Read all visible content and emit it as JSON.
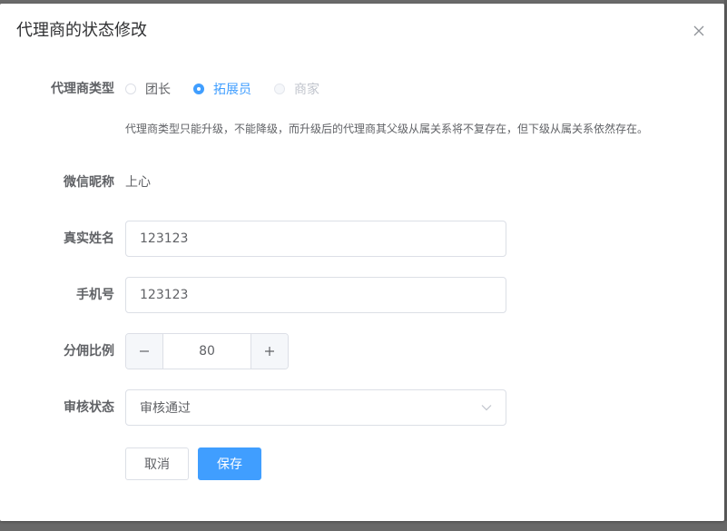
{
  "dialog": {
    "title": "代理商的状态修改",
    "close_icon": "close-icon"
  },
  "form": {
    "agent_type": {
      "label": "代理商类型",
      "options": [
        {
          "label": "团长",
          "state": "unchecked"
        },
        {
          "label": "拓展员",
          "state": "checked"
        },
        {
          "label": "商家",
          "state": "disabled"
        }
      ],
      "hint": "代理商类型只能升级，不能降级，而升级后的代理商其父级从属关系将不复存在，但下级从属关系依然存在。"
    },
    "wechat_nickname": {
      "label": "微信昵称",
      "value": "上心"
    },
    "real_name": {
      "label": "真实姓名",
      "value": "123123"
    },
    "phone": {
      "label": "手机号",
      "value": "123123"
    },
    "commission_ratio": {
      "label": "分佣比例",
      "value": "80",
      "minus_icon": "minus-icon",
      "plus_icon": "plus-icon"
    },
    "review_status": {
      "label": "审核状态",
      "value": "审核通过",
      "chevron_icon": "chevron-down-icon"
    }
  },
  "actions": {
    "cancel_label": "取消",
    "save_label": "保存"
  },
  "colors": {
    "primary": "#409eff",
    "text": "#606266",
    "border": "#dcdfe6",
    "title": "#303133"
  }
}
